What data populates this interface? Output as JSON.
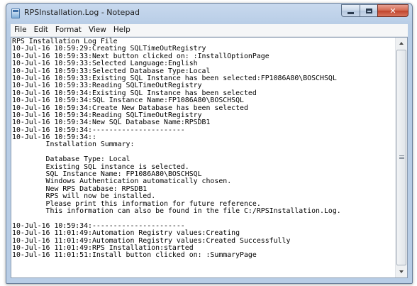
{
  "window": {
    "title": "RPSInstallation.Log - Notepad"
  },
  "menu": [
    "File",
    "Edit",
    "Format",
    "View",
    "Help"
  ],
  "document": {
    "lines": [
      "RPS Installation Log File",
      "10-Jul-16 10:59:29:Creating SQLTimeOutRegistry",
      "10-Jul-16 10:59:33:Next button clicked on: :InstallOptionPage",
      "10-Jul-16 10:59:33:Selected Language:English",
      "10-Jul-16 10:59:33:Selected Database Type:Local",
      "10-Jul-16 10:59:33:Existing SQL Instance has been selected:FP1086A80\\BOSCHSQL",
      "10-Jul-16 10:59:33:Reading SQLTimeOutRegistry",
      "10-Jul-16 10:59:34:Existing SQL Instance has been selected",
      "10-Jul-16 10:59:34:SQL Instance Name:FP1086A80\\BOSCHSQL",
      "10-Jul-16 10:59:34:Create New Database has been selected",
      "10-Jul-16 10:59:34:Reading SQLTimeOutRegistry",
      "10-Jul-16 10:59:34:New SQL Database Name:RPSDB1",
      "10-Jul-16 10:59:34:----------------------",
      "10-Jul-16 10:59:34::",
      "        Installation Summary:",
      "",
      "        Database Type: Local",
      "        Existing SQL instance is selected.",
      "        SQL Instance Name: FP1086A80\\BOSCHSQL",
      "        Windows Authentication automatically chosen.",
      "        New RPS Database: RPSDB1",
      "        RPS will now be installed.",
      "        Please print this information for future reference.",
      "        This information can also be found in the file C:/RPSInstallation.Log.",
      "",
      "10-Jul-16 10:59:34:----------------------",
      "10-Jul-16 11:01:49:Automation Registry values:Creating",
      "10-Jul-16 11:01:49:Automation Registry values:Created Successfully",
      "10-Jul-16 11:01:49:RPS Installation:started",
      "10-Jul-16 11:01:51:Install button clicked on: :SummaryPage"
    ]
  }
}
